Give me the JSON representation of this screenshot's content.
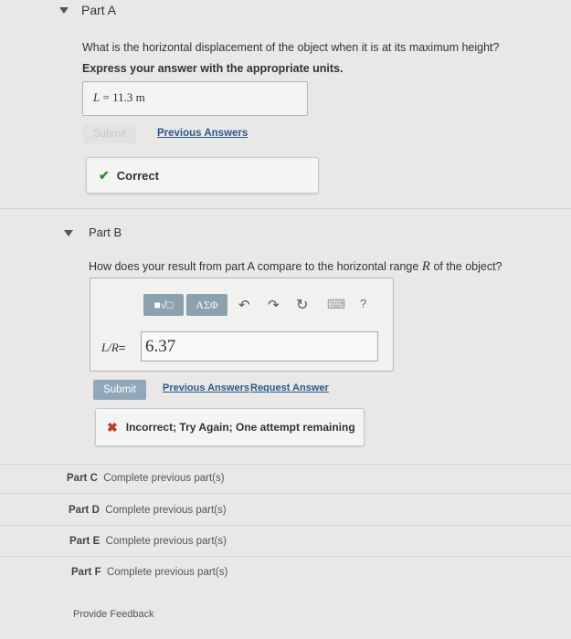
{
  "part_a": {
    "title": "Part A",
    "question": "What is the horizontal displacement of the object when it is at its maximum height?",
    "instruction": "Express your answer with the appropriate units.",
    "answer_var": "L",
    "answer_eq": " = ",
    "answer_value": "11.3 m",
    "submit_label": "Submit",
    "previous_answers": "Previous Answers",
    "feedback": "Correct"
  },
  "part_b": {
    "title": "Part B",
    "question_prefix": "How does your result from part A compare to the horizontal range",
    "question_var": "R",
    "question_suffix": "of the object?",
    "toolbar": {
      "templates": "■√□",
      "symbols": "ΑΣΦ",
      "undo": "↶",
      "redo": "↷",
      "reset": "↻",
      "keyboard": "⌨",
      "help": "?"
    },
    "answer_label": "L/R",
    "answer_eq": "=",
    "answer_value": "6.37",
    "submit_label": "Submit",
    "previous_answers": "Previous Answers",
    "request_answer": "Request Answer",
    "feedback": "Incorrect; Try Again; One attempt remaining"
  },
  "other_parts": [
    {
      "label": "Part C",
      "status": "Complete previous part(s)"
    },
    {
      "label": "Part D",
      "status": "Complete previous part(s)"
    },
    {
      "label": "Part E",
      "status": "Complete previous part(s)"
    },
    {
      "label": "Part F",
      "status": "Complete previous part(s)"
    }
  ],
  "footer": {
    "feedback_link": "Provide Feedback"
  },
  "colors": {
    "correct": "#2f8a2f",
    "incorrect": "#c0392b",
    "submit_active": "#8fa7b8",
    "link": "#2a5a8a"
  }
}
